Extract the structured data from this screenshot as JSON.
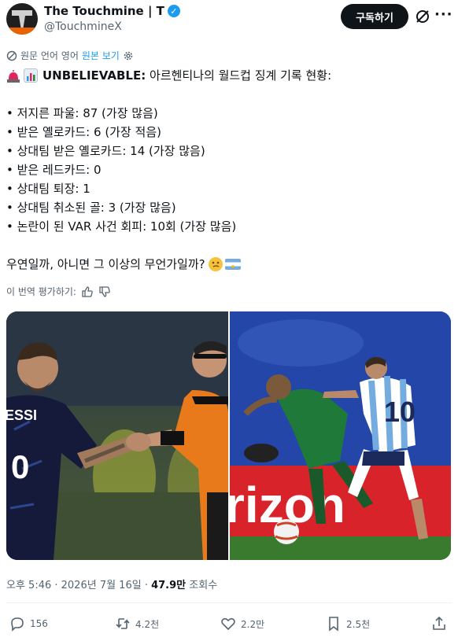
{
  "author": {
    "display_name": "The Touchmine | T",
    "handle": "@TouchmineX",
    "subscribe_label": "구독하기"
  },
  "translation": {
    "label": "원문 언어 영어",
    "show_original": "원본 보기"
  },
  "tweet": {
    "headline_bold": "UNBELIEVABLE:",
    "headline_rest": " 아르헨티나의 월드컵 징계 기록 현황:",
    "bullets": [
      "• 저지른 파울: 87 (가장 많음)",
      "• 받은 옐로카드: 6 (가장 적음)",
      "• 상대팀 받은 옐로카드: 14 (가장 많음)",
      "• 받은 레드카드: 0",
      "• 상대팀 퇴장: 1",
      "• 상대팀 취소된 골: 3 (가장 많음)",
      "• 논란이 된 VAR 사건 회피: 10회 (가장 많음)"
    ],
    "closing": "우연일까, 아니면 그 이상의 무언가일까?"
  },
  "rate_translation": "이 번역 평가하기:",
  "images": {
    "left_jersey_text": "ESSI",
    "right_board_text": "rizon"
  },
  "meta": {
    "time": "오후 5:46 · 2026년 7월 16일 · ",
    "views": "47.9만",
    "views_label": " 조회수"
  },
  "actions": {
    "replies": "156",
    "reposts": "4.2천",
    "likes": "2.2만",
    "bookmarks": "2.5천"
  },
  "colors": {
    "accent": "#1d9bf0",
    "text": "#0f1419",
    "muted": "#536471"
  }
}
